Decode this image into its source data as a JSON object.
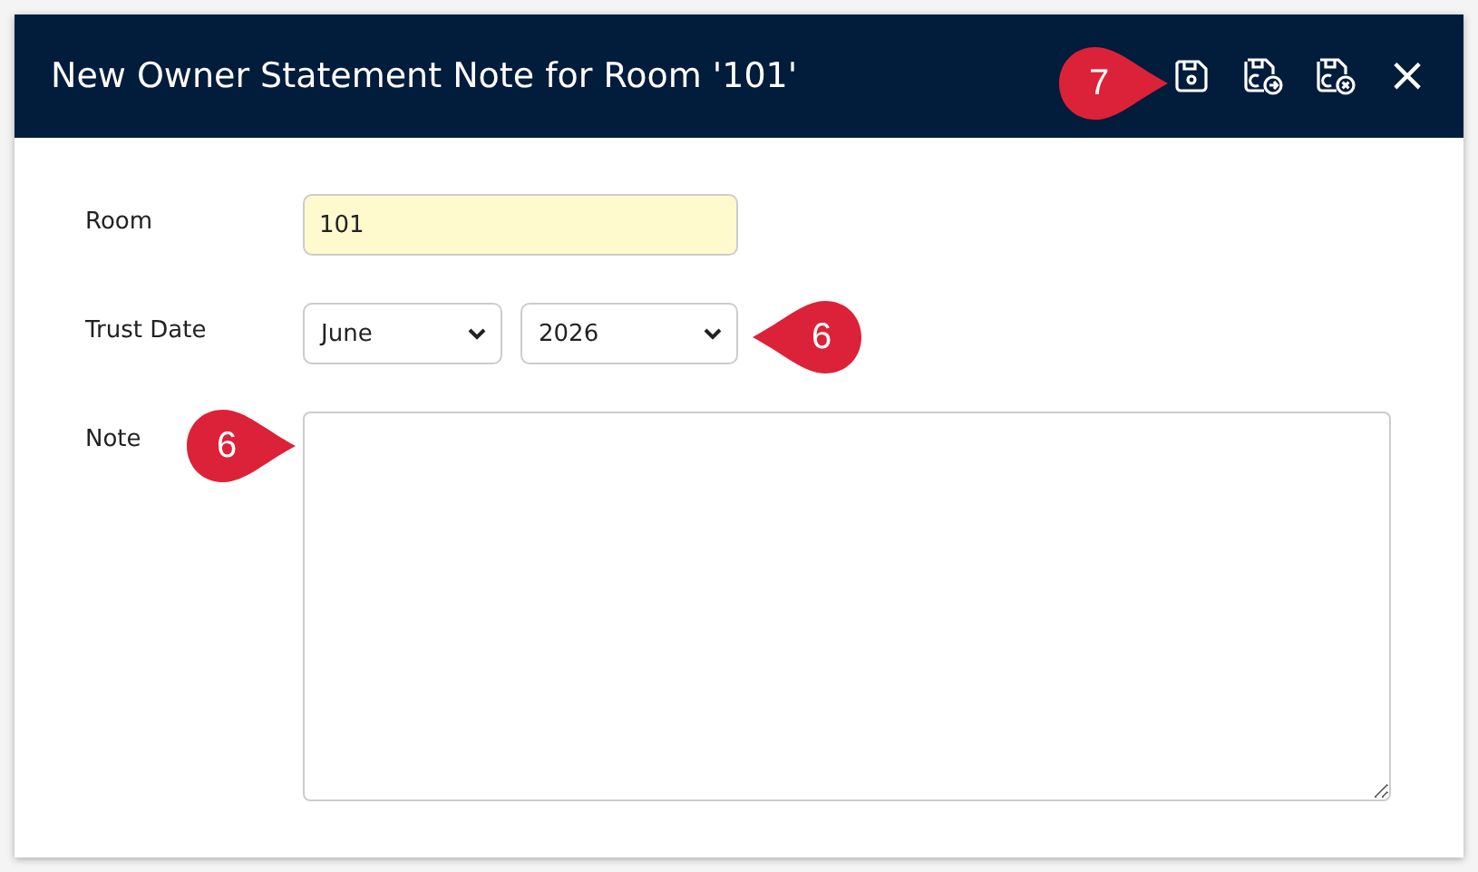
{
  "window": {
    "title": "New Owner Statement Note for Room '101'",
    "close": "×"
  },
  "form": {
    "room": {
      "label": "Room",
      "value": "101"
    },
    "trust_date": {
      "label": "Trust Date",
      "month": "June",
      "year": "2026"
    },
    "note": {
      "label": "Note"
    }
  },
  "callouts": [
    {
      "label": "7"
    },
    {
      "label": "6"
    },
    {
      "label": "6"
    }
  ]
}
